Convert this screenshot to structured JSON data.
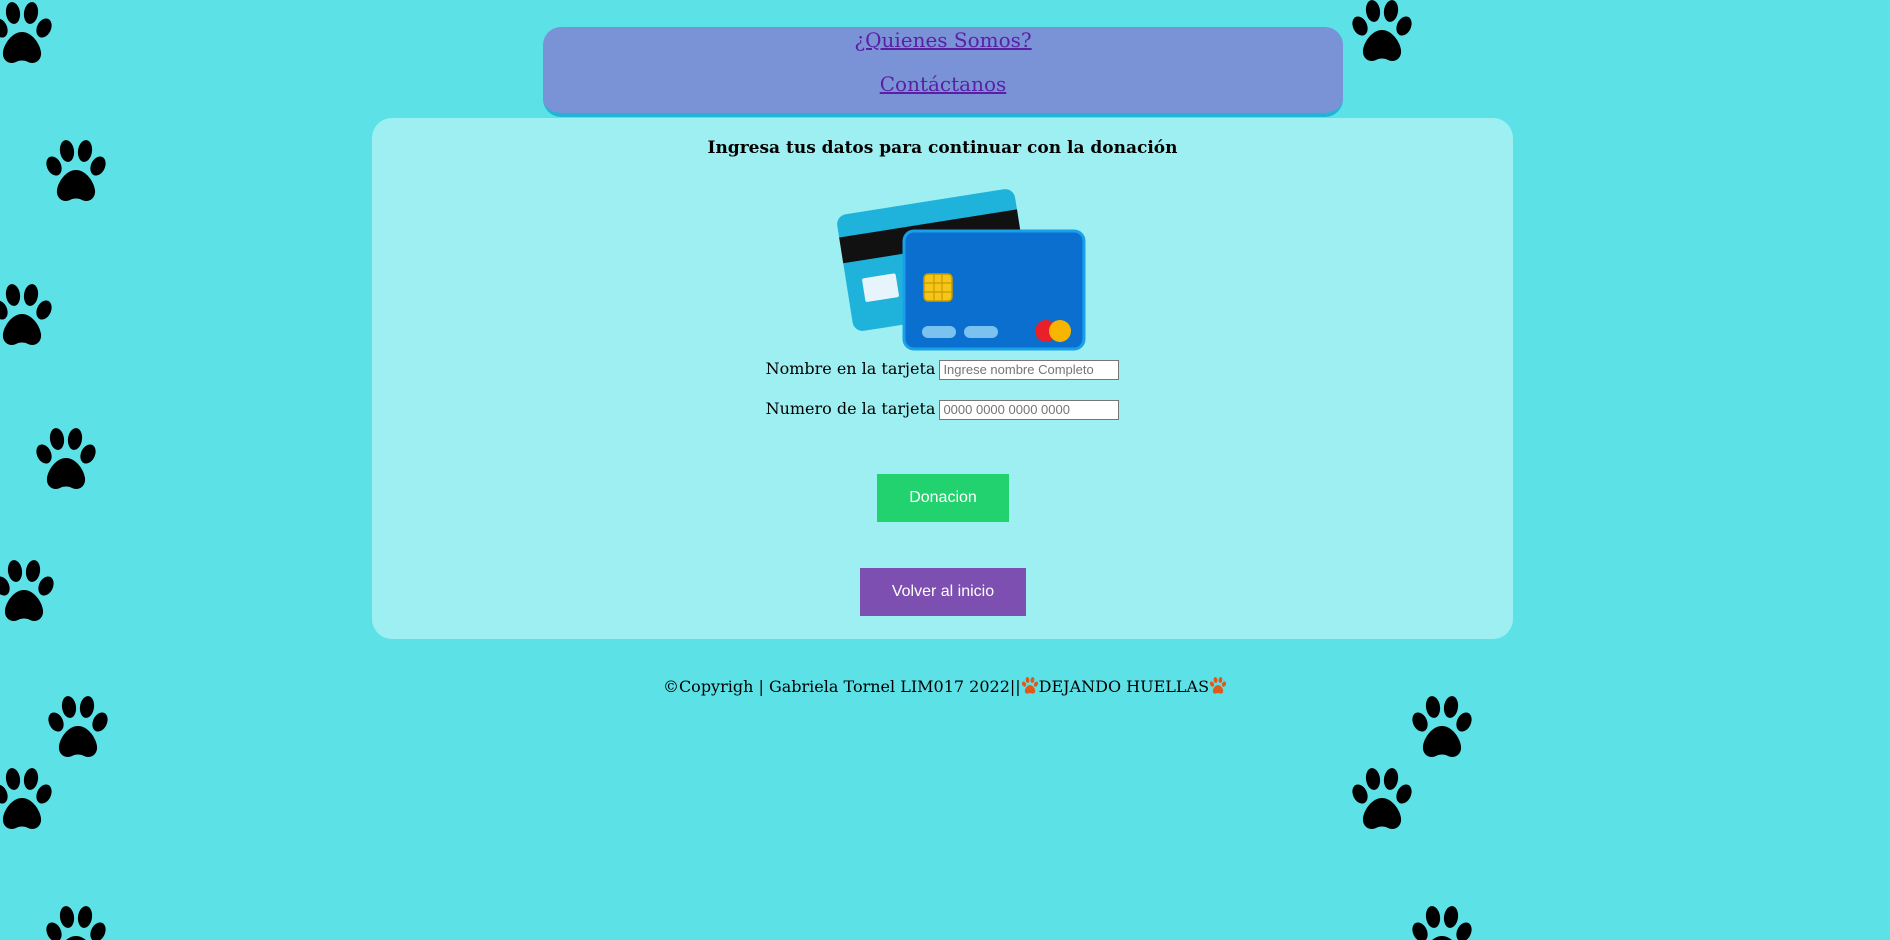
{
  "nav": {
    "link_about": "¿Quienes Somos?",
    "link_contact": "Contáctanos"
  },
  "main": {
    "title": "Ingresa tus datos para continuar con la donación",
    "name_label": "Nombre en la tarjeta",
    "name_placeholder": "Ingrese nombre Completo",
    "number_label": "Numero de la tarjeta",
    "number_placeholder": "0000 0000 0000 0000",
    "donate_button": "Donacion",
    "home_button": "Volver al inicio"
  },
  "footer": {
    "copyright": "©Copyrigh | Gabriela Tornel LIM017 2022||",
    "brand": "DEJANDO HUELLAS"
  },
  "colors": {
    "background": "#5ce1e6",
    "nav_bg": "#7a93d6",
    "panel_bg": "#9eeff2",
    "donate_btn": "#21d26e",
    "home_btn": "#7c4fb0",
    "paw_dark": "#000000",
    "paw_grey": "#636e6e"
  },
  "icons": {
    "decoration": "paw-print-icon",
    "card": "credit-card-icon"
  }
}
